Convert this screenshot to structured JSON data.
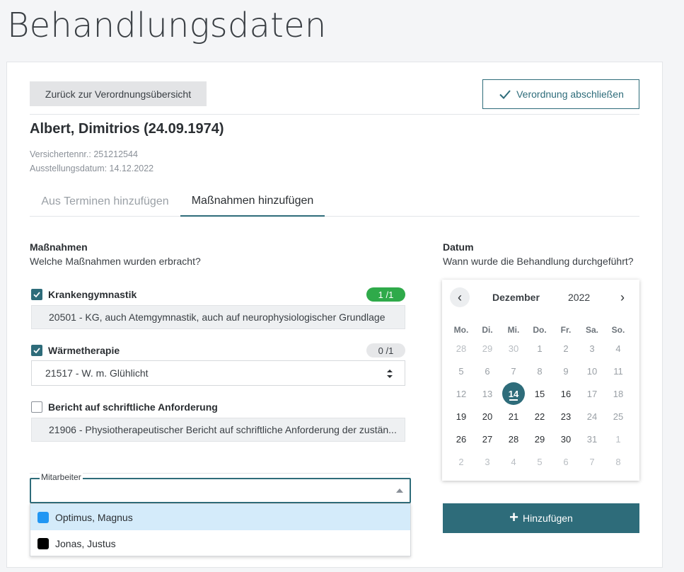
{
  "page": {
    "title": "Behandlungsdaten"
  },
  "header": {
    "back_label": "Zurück zur Verordnungsübersicht",
    "finish_label": "Verordnung abschließen"
  },
  "patient": {
    "name": "Albert, Dimitrios (24.09.1974)",
    "insurance_no": "Versichertennr.: 251212544",
    "issue_date": "Ausstellungsdatum: 14.12.2022"
  },
  "tabs": [
    {
      "label": "Aus Terminen hinzufügen",
      "active": false
    },
    {
      "label": "Maßnahmen hinzufügen",
      "active": true
    }
  ],
  "measures": {
    "title": "Maßnahmen",
    "subtitle": "Welche Maßnahmen wurden erbracht?",
    "items": [
      {
        "label": "Krankengymnastik",
        "checked": true,
        "count": "1 /1",
        "count_color": "#2faa4a",
        "value": "20501 - KG, auch Atemgymnastik, auch auf neurophysiologischer Grundlage"
      },
      {
        "label": "Wärmetherapie",
        "checked": true,
        "count": "0 /1",
        "count_color": "#e6e7e9",
        "value": "21517 - W. m. Glühlicht"
      },
      {
        "label": "Bericht auf schriftliche Anforderung",
        "checked": false,
        "value": "21906 - Physiotherapeutischer Bericht auf schriftliche Anforderung der zustän..."
      }
    ]
  },
  "employee": {
    "legend": "Mitarbeiter",
    "options": [
      {
        "label": "Optimus, Magnus",
        "color": "#2196f3",
        "highlighted": true
      },
      {
        "label": "Jonas, Justus",
        "color": "#000000",
        "highlighted": false
      }
    ]
  },
  "date": {
    "title": "Datum",
    "subtitle": "Wann wurde die Behandlung durchgeführt?"
  },
  "calendar": {
    "month": "Dezember",
    "year": "2022",
    "prev_icon": "‹",
    "next_icon": "›",
    "weekdays": [
      "Mo.",
      "Di.",
      "Mi.",
      "Do.",
      "Fr.",
      "Sa.",
      "So."
    ],
    "weeks": [
      [
        "28",
        "29",
        "30",
        "1",
        "2",
        "3",
        "4"
      ],
      [
        "5",
        "6",
        "7",
        "8",
        "9",
        "10",
        "11"
      ],
      [
        "12",
        "13",
        "14",
        "15",
        "16",
        "17",
        "18"
      ],
      [
        "19",
        "20",
        "21",
        "22",
        "23",
        "24",
        "25"
      ],
      [
        "26",
        "27",
        "28",
        "29",
        "30",
        "31",
        "1"
      ],
      [
        "2",
        "3",
        "4",
        "5",
        "6",
        "7",
        "8"
      ]
    ],
    "selected": "14"
  },
  "add_button": {
    "label": "Hinzufügen",
    "icon": "plus-icon"
  },
  "colors": {
    "accent": "#2e6c7a",
    "success": "#2faa4a",
    "highlight": "#d4ebfa"
  }
}
